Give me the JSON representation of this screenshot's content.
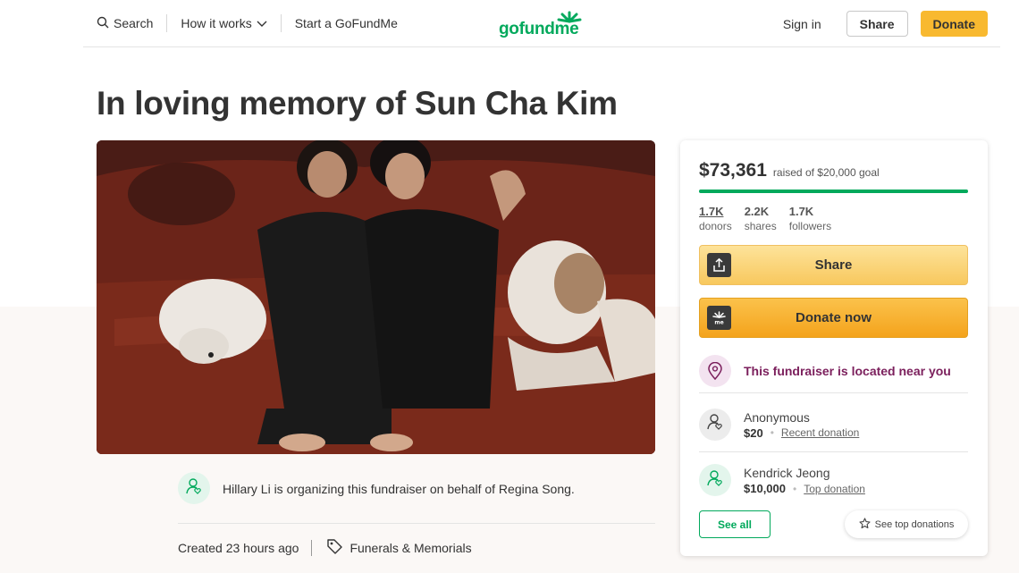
{
  "header": {
    "search_label": "Search",
    "how_label": "How it works",
    "start_label": "Start a GoFundMe",
    "logo_text": "gofundme",
    "signin_label": "Sign in",
    "share_label": "Share",
    "donate_label": "Donate"
  },
  "page": {
    "title": "In loving memory of Sun Cha Kim",
    "organizer_text": "Hillary Li is organizing this fundraiser on behalf of Regina Song.",
    "created": "Created 23 hours ago",
    "category": "Funerals & Memorials"
  },
  "card": {
    "amount": "$73,361",
    "goal_text": "raised of $20,000 goal",
    "progress_fraction": 1.0,
    "stats": [
      {
        "num": "1.7K",
        "label": "donors"
      },
      {
        "num": "2.2K",
        "label": "shares"
      },
      {
        "num": "1.7K",
        "label": "followers"
      }
    ],
    "share_label": "Share",
    "donate_label": "Donate now",
    "location_text": "This fundraiser is located near you",
    "donations": [
      {
        "name": "Anonymous",
        "amount": "$20",
        "kind": "Recent donation"
      },
      {
        "name": "Kendrick Jeong",
        "amount": "$10,000",
        "kind": "Top donation"
      }
    ],
    "see_all_label": "See all",
    "see_top_label": "See top donations"
  },
  "colors": {
    "brand_green": "#02a95c",
    "donate_yellow": "#f8b930",
    "location_purple": "#7b1f5c"
  },
  "icons": {
    "search": "search-icon",
    "chevron": "chevron-down-icon",
    "share": "upload-icon",
    "donate": "gofundme-mark-icon",
    "location": "map-pin-icon",
    "user": "user-heart-icon",
    "tag": "tag-icon",
    "star": "star-icon"
  }
}
